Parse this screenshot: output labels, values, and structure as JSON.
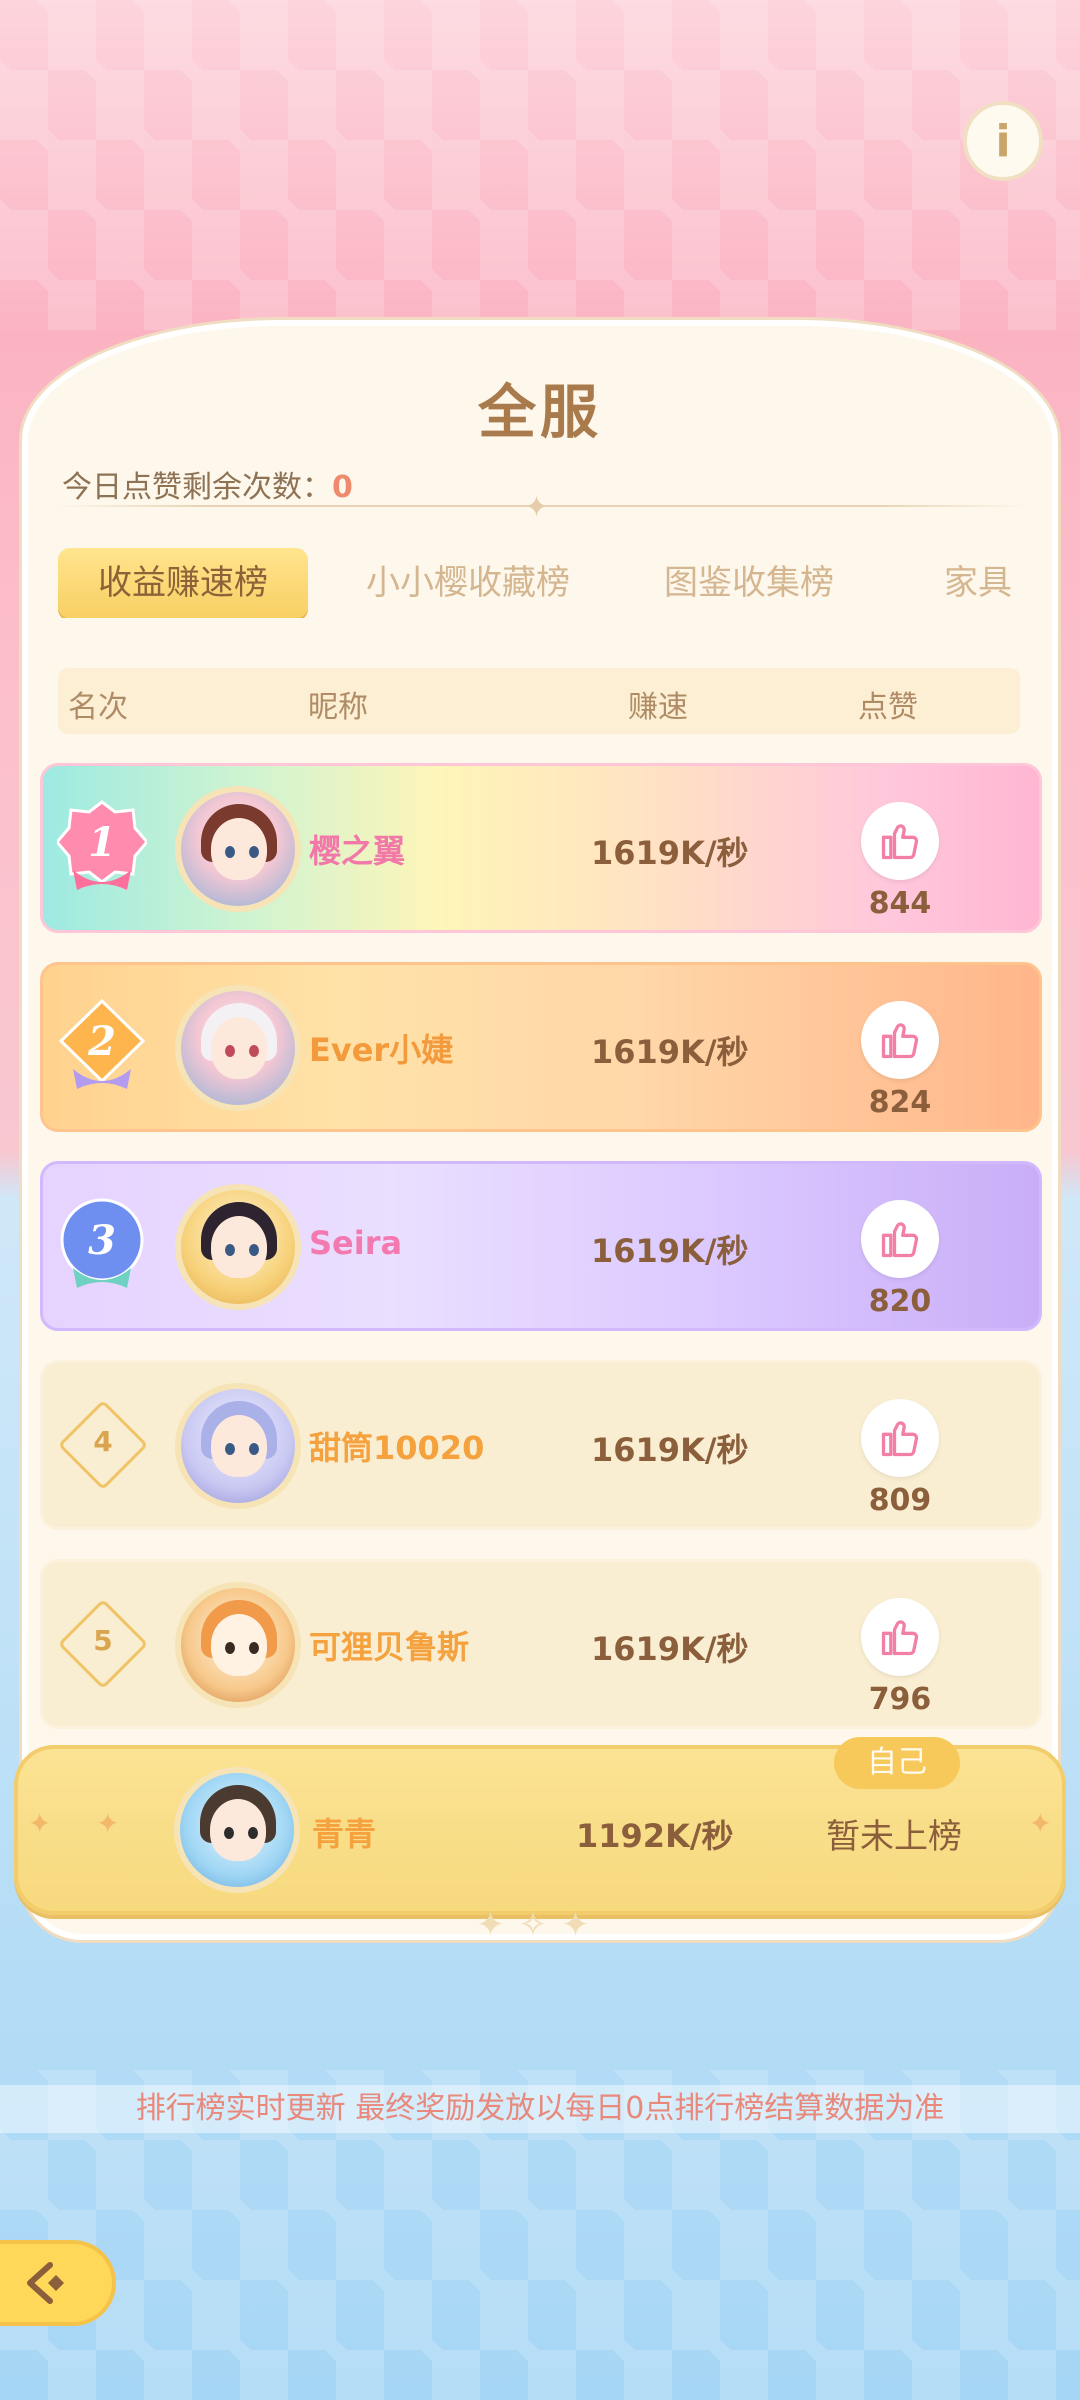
{
  "header": {
    "title": "全服",
    "likes_remaining_label": "今日点赞剩余次数：",
    "likes_remaining_value": "0"
  },
  "tabs": [
    {
      "label": "收益赚速榜",
      "active": true
    },
    {
      "label": "小小樱收藏榜",
      "active": false
    },
    {
      "label": "图鉴收集榜",
      "active": false
    },
    {
      "label": "家具",
      "active": false
    }
  ],
  "columns": {
    "rank": "名次",
    "nickname": "昵称",
    "speed": "赚速",
    "like": "点赞"
  },
  "rows": [
    {
      "rank": "1",
      "name": "樱之翼",
      "speed": "1619K/秒",
      "likes": "844",
      "name_color": "#f178a8"
    },
    {
      "rank": "2",
      "name": "Ever小婕",
      "speed": "1619K/秒",
      "likes": "824",
      "name_color": "#f39a3c"
    },
    {
      "rank": "3",
      "name": "Seira",
      "speed": "1619K/秒",
      "likes": "820",
      "name_color": "#f37ab0"
    },
    {
      "rank": "4",
      "name": "甜筒10020",
      "speed": "1619K/秒",
      "likes": "809",
      "name_color": "#f4a13e"
    },
    {
      "rank": "5",
      "name": "可狸贝鲁斯",
      "speed": "1619K/秒",
      "likes": "796",
      "name_color": "#f4a13e"
    }
  ],
  "self": {
    "tag": "自己",
    "name": "青青",
    "speed": "1192K/秒",
    "status": "暂未上榜"
  },
  "footer_notice": "排行榜实时更新 最终奖励发放以每日0点排行榜结算数据为准",
  "icons": {
    "info": "info-icon",
    "like": "thumbs-up-icon",
    "back": "back-arrow-icon"
  },
  "colors": {
    "accent_gold": "#f8cf63",
    "title_brown": "#a97b4c",
    "like_pink": "#f27fa6"
  }
}
